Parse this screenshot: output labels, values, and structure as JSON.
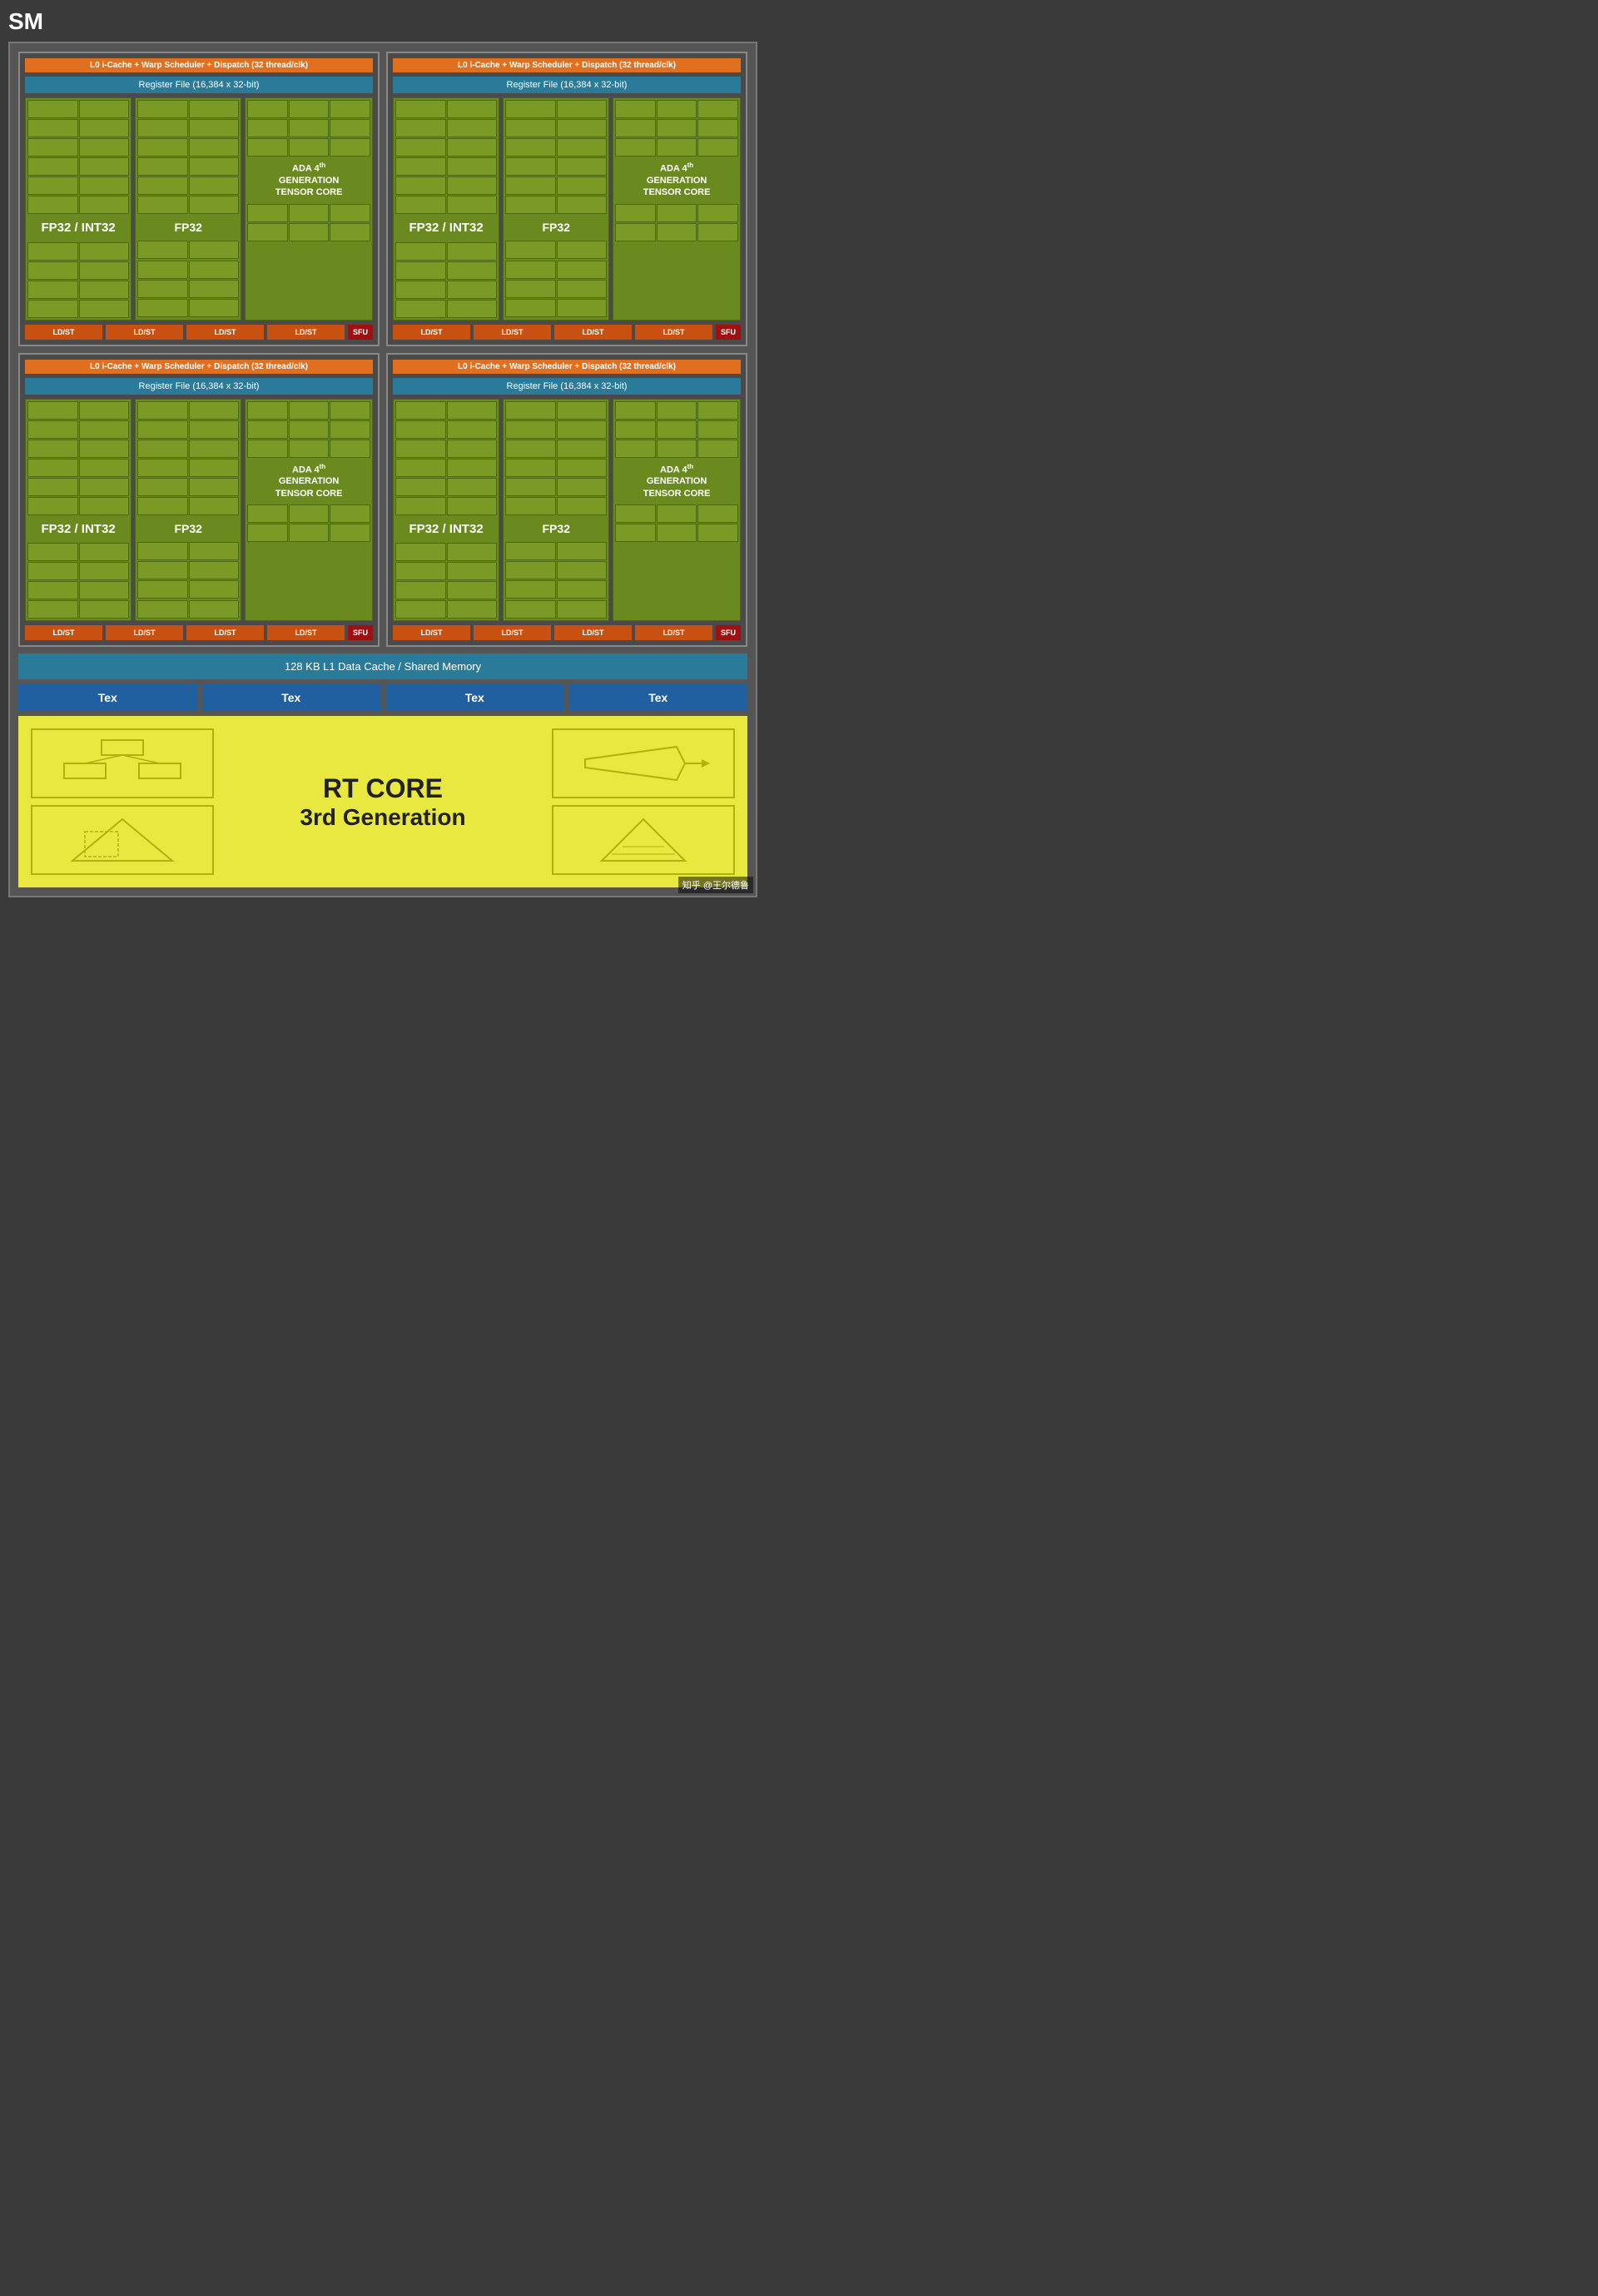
{
  "title": "SM",
  "sub_units": [
    {
      "warp_label": "L0 i-Cache + Warp Scheduler + Dispatch (32 thread/clk)",
      "reg_label": "Register File (16,384 x 32-bit)",
      "fp32_int32": "FP32\n/\nINT32",
      "fp32": "FP32",
      "tensor_label": "ADA 4th GENERATION TENSOR CORE",
      "ldst_items": [
        "LD/ST",
        "LD/ST",
        "LD/ST",
        "LD/ST"
      ],
      "sfu": "SFU"
    },
    {
      "warp_label": "L0 i-Cache + Warp Scheduler + Dispatch (32 thread/clk)",
      "reg_label": "Register File (16,384 x 32-bit)",
      "fp32_int32": "FP32\n/\nINT32",
      "fp32": "FP32",
      "tensor_label": "ADA 4th GENERATION TENSOR CORE",
      "ldst_items": [
        "LD/ST",
        "LD/ST",
        "LD/ST",
        "LD/ST"
      ],
      "sfu": "SFU"
    },
    {
      "warp_label": "L0 i-Cache + Warp Scheduler + Dispatch (32 thread/clk)",
      "reg_label": "Register File (16,384 x 32-bit)",
      "fp32_int32": "FP32\n/\nINT32",
      "fp32": "FP32",
      "tensor_label": "ADA 4th GENERATION TENSOR CORE",
      "ldst_items": [
        "LD/ST",
        "LD/ST",
        "LD/ST",
        "LD/ST"
      ],
      "sfu": "SFU"
    },
    {
      "warp_label": "L0 i-Cache + Warp Scheduler + Dispatch (32 thread/clk)",
      "reg_label": "Register File (16,384 x 32-bit)",
      "fp32_int32": "FP32\n/\nINT32",
      "fp32": "FP32",
      "tensor_label": "ADA 4th GENERATION TENSOR CORE",
      "ldst_items": [
        "LD/ST",
        "LD/ST",
        "LD/ST",
        "LD/ST"
      ],
      "sfu": "SFU"
    }
  ],
  "l1_cache": "128 KB L1 Data Cache / Shared Memory",
  "tex_items": [
    "Tex",
    "Tex",
    "Tex",
    "Tex"
  ],
  "rt_core": {
    "title": "RT CORE",
    "subtitle": "3rd Generation"
  },
  "watermark": "知乎 @王尔德鲁"
}
